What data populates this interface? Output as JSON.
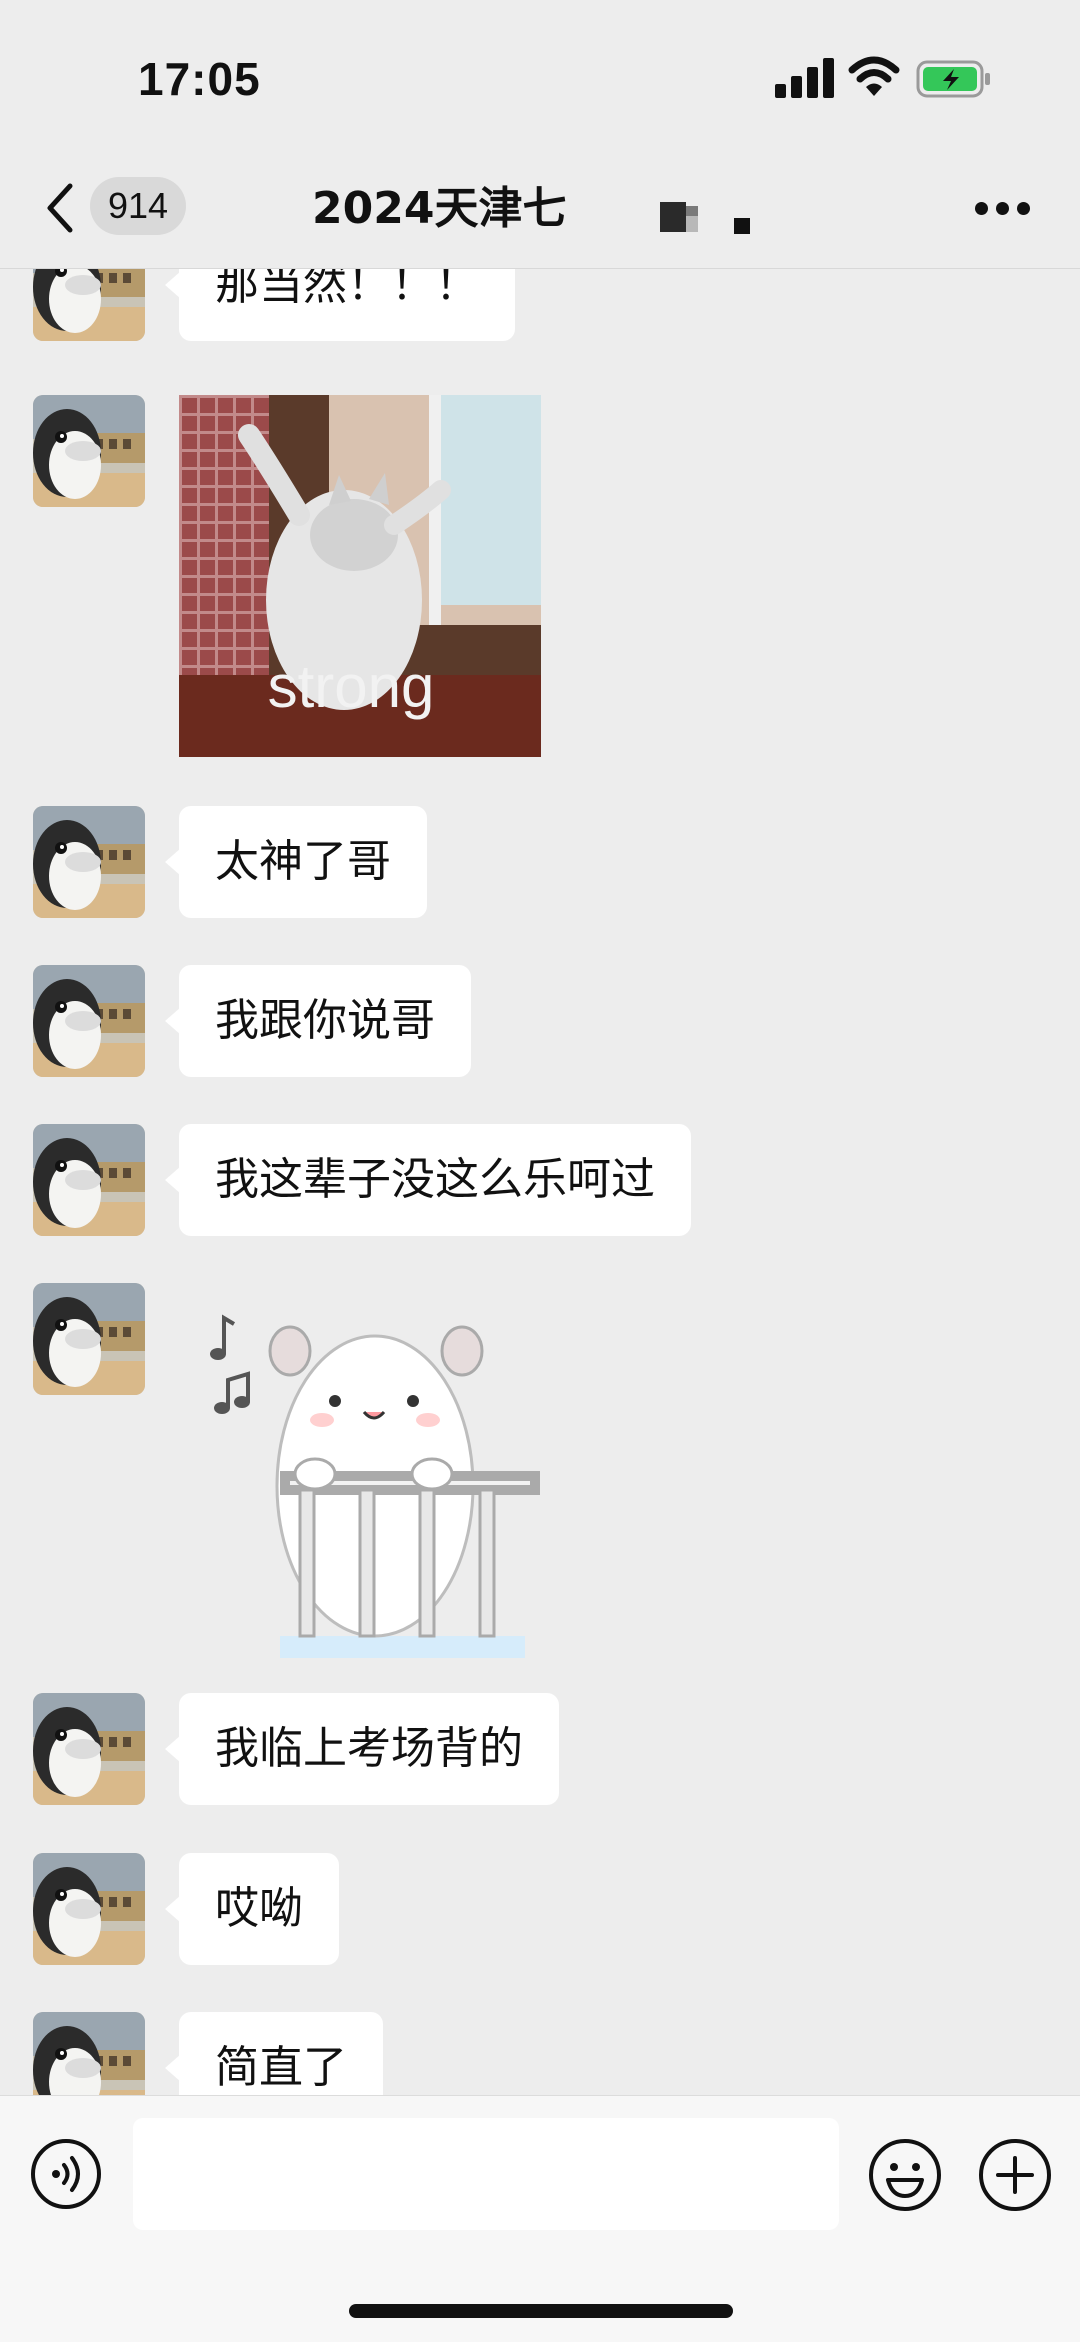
{
  "status_bar": {
    "time": "17:05",
    "battery_color": "#34c759"
  },
  "header": {
    "unread_count": "914",
    "title": "2024天津七"
  },
  "messages": [
    {
      "type": "text",
      "text": "那当然！！！"
    },
    {
      "type": "sticker",
      "sticker": "cat-standing-strong",
      "caption": "strong"
    },
    {
      "type": "text",
      "text": "太神了哥"
    },
    {
      "type": "text",
      "text": "我跟你说哥"
    },
    {
      "type": "text",
      "text": "我这辈子没这么乐呵过"
    },
    {
      "type": "sticker",
      "sticker": "hamster-singing-music-notes-icon"
    },
    {
      "type": "text",
      "text": "我临上考场背的"
    },
    {
      "type": "text",
      "text": "哎呦"
    },
    {
      "type": "text",
      "text": "简直了"
    }
  ],
  "input": {
    "value": "",
    "placeholder": ""
  },
  "icons": {
    "back": "chevron-left-icon",
    "more": "more-dots-icon",
    "voice": "voice-icon",
    "emoji": "emoji-icon",
    "plus": "plus-icon"
  }
}
